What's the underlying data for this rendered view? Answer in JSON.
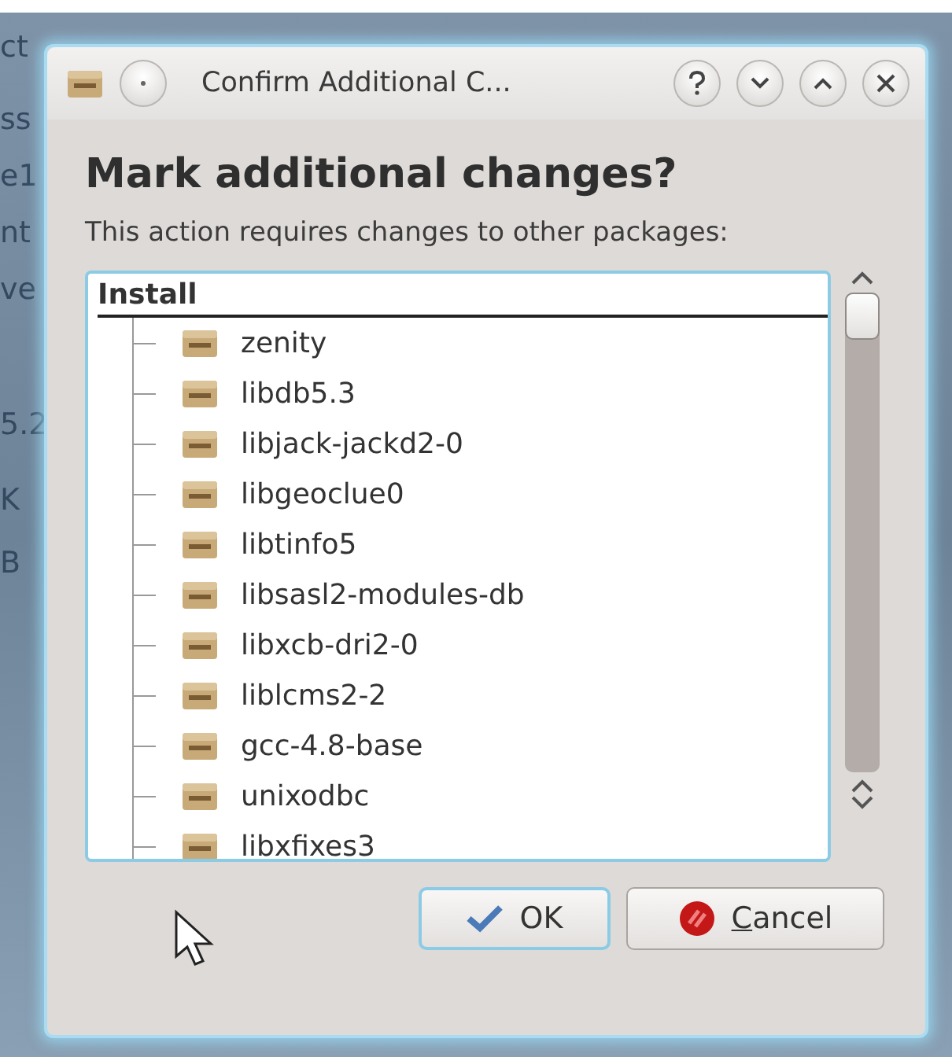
{
  "background": {
    "texts": [
      "ct",
      "ss",
      "e1",
      "nt",
      "ve",
      "5.2",
      "K",
      "B"
    ]
  },
  "dialog": {
    "title": "Confirm Additional C...",
    "heading": "Mark additional changes?",
    "message": "This action requires changes to other packages:",
    "tree": {
      "label": "Install",
      "children": [
        {
          "label": "zenity"
        },
        {
          "label": "libdb5.3"
        },
        {
          "label": "libjack-jackd2-0"
        },
        {
          "label": "libgeoclue0"
        },
        {
          "label": "libtinfo5"
        },
        {
          "label": "libsasl2-modules-db"
        },
        {
          "label": "libxcb-dri2-0"
        },
        {
          "label": "liblcms2-2"
        },
        {
          "label": "gcc-4.8-base"
        },
        {
          "label": "unixodbc"
        },
        {
          "label": "libxfixes3"
        }
      ]
    },
    "buttons": [
      {
        "label": "OK",
        "kind": "ok",
        "focused": true,
        "underline_first": false
      },
      {
        "label": "Cancel",
        "kind": "cancel",
        "focused": false,
        "underline_first": true
      }
    ]
  }
}
